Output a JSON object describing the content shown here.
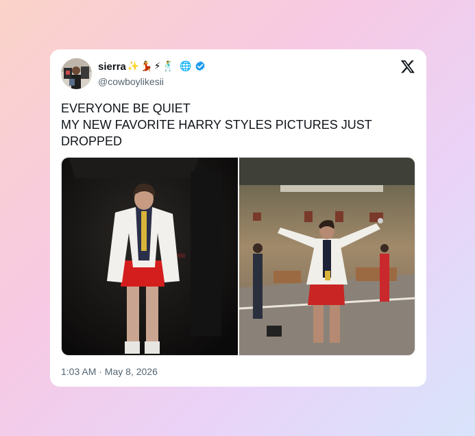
{
  "tweet": {
    "display_name": "sierra",
    "name_emojis": [
      "✨",
      "💃",
      "⚡",
      "🕺",
      "🌐"
    ],
    "verified": true,
    "handle": "@cowboylikesii",
    "platform_icon": "x-logo-icon",
    "text_lines": [
      "EVERYONE BE QUIET",
      "MY NEW FAVORITE HARRY STYLES PICTURES JUST",
      "DROPPED"
    ],
    "timestamp": "1:03 AM · May 8, 2026"
  },
  "media": [
    {
      "name": "photo-backstage",
      "icon": "photo"
    },
    {
      "name": "photo-stage",
      "icon": "photo"
    }
  ],
  "colors": {
    "text_primary": "#0f1419",
    "text_secondary": "#536471",
    "verified_blue": "#1d9bf0",
    "card_bg": "#ffffff"
  }
}
